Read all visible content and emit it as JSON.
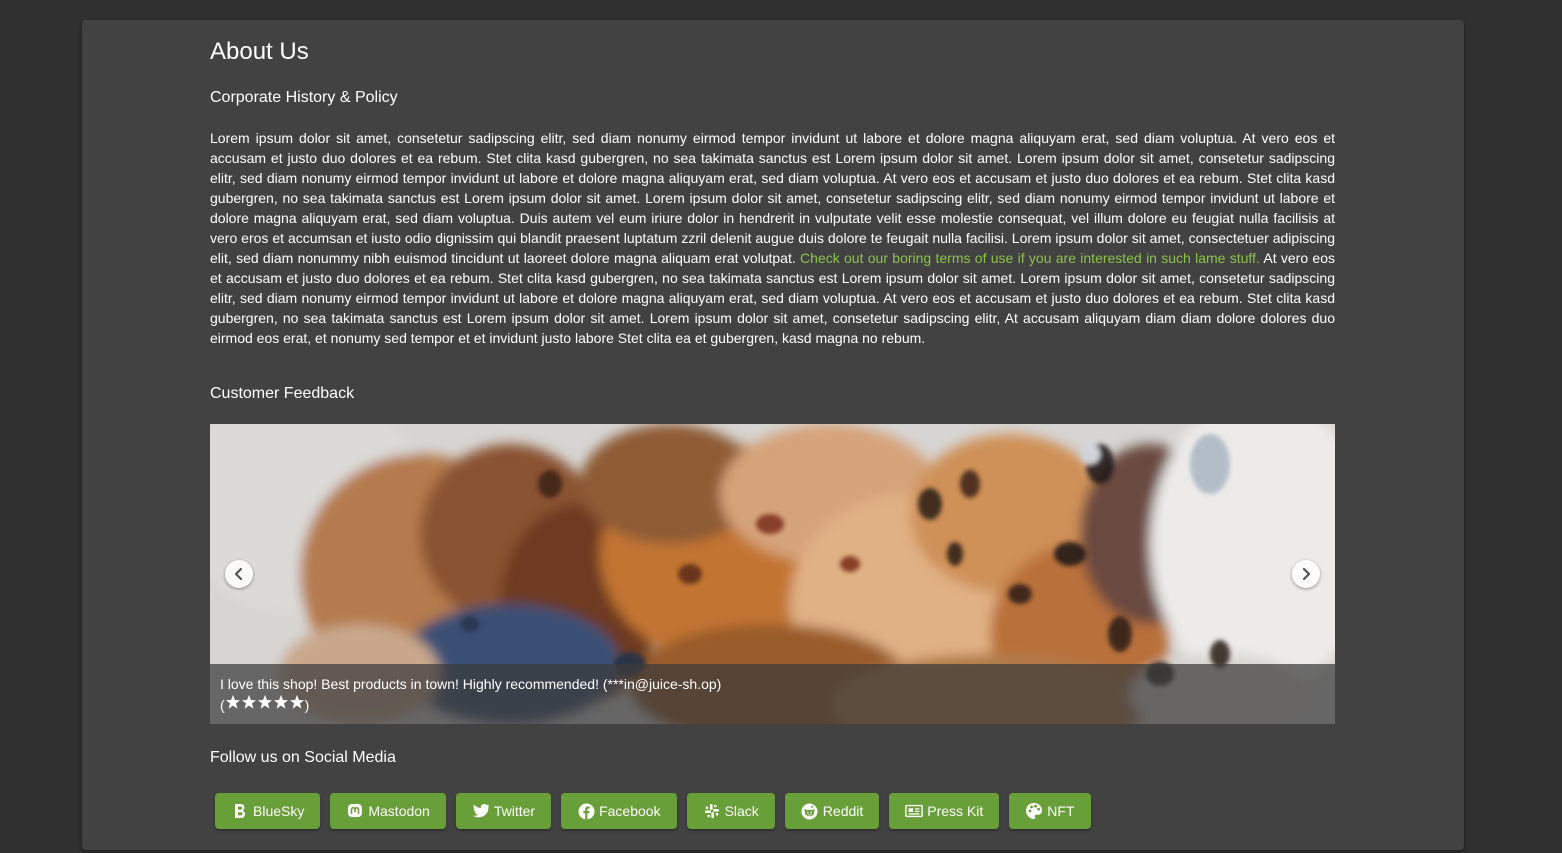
{
  "page": {
    "title": "About Us",
    "corporate_heading": "Corporate History & Policy",
    "policy_text_before": "Lorem ipsum dolor sit amet, consetetur sadipscing elitr, sed diam nonumy eirmod tempor invidunt ut labore et dolore magna aliquyam erat, sed diam voluptua. At vero eos et accusam et justo duo dolores et ea rebum. Stet clita kasd gubergren, no sea takimata sanctus est Lorem ipsum dolor sit amet. Lorem ipsum dolor sit amet, consetetur sadipscing elitr, sed diam nonumy eirmod tempor invidunt ut labore et dolore magna aliquyam erat, sed diam voluptua. At vero eos et accusam et justo duo dolores et ea rebum. Stet clita kasd gubergren, no sea takimata sanctus est Lorem ipsum dolor sit amet. Lorem ipsum dolor sit amet, consetetur sadipscing elitr, sed diam nonumy eirmod tempor invidunt ut labore et dolore magna aliquyam erat, sed diam voluptua. Duis autem vel eum iriure dolor in hendrerit in vulputate velit esse molestie consequat, vel illum dolore eu feugiat nulla facilisis at vero eros et accumsan et iusto odio dignissim qui blandit praesent luptatum zzril delenit augue duis dolore te feugait nulla facilisi. Lorem ipsum dolor sit amet, consectetuer adipiscing elit, sed diam nonummy nibh euismod tincidunt ut laoreet dolore magna aliquam erat volutpat.",
    "policy_link": "Check out our boring terms of use if you are interested in such lame stuff.",
    "policy_text_after": "At vero eos et accusam et justo duo dolores et ea rebum. Stet clita kasd gubergren, no sea takimata sanctus est Lorem ipsum dolor sit amet. Lorem ipsum dolor sit amet, consetetur sadipscing elitr, sed diam nonumy eirmod tempor invidunt ut labore et dolore magna aliquyam erat, sed diam voluptua. At vero eos et accusam et justo duo dolores et ea rebum. Stet clita kasd gubergren, no sea takimata sanctus est Lorem ipsum dolor sit amet. Lorem ipsum dolor sit amet, consetetur sadipscing elitr, At accusam aliquyam diam diam dolore dolores duo eirmod eos erat, et nonumy sed tempor et et invidunt justo labore Stet clita ea et gubergren, kasd magna no rebum.",
    "feedback_heading": "Customer Feedback",
    "social_heading": "Follow us on Social Media"
  },
  "carousel": {
    "caption": "I love this shop! Best products in town! Highly recommended! (***in@juice-sh.op)",
    "rating": 5,
    "rating_open": "(",
    "rating_close": ")",
    "prev_icon": "chevron-left-icon",
    "next_icon": "chevron-right-icon"
  },
  "social": [
    {
      "label": "BlueSky",
      "icon": "bluesky-icon"
    },
    {
      "label": "Mastodon",
      "icon": "mastodon-icon"
    },
    {
      "label": "Twitter",
      "icon": "twitter-icon"
    },
    {
      "label": "Facebook",
      "icon": "facebook-icon"
    },
    {
      "label": "Slack",
      "icon": "slack-icon"
    },
    {
      "label": "Reddit",
      "icon": "reddit-icon"
    },
    {
      "label": "Press Kit",
      "icon": "newspaper-icon"
    },
    {
      "label": "NFT",
      "icon": "palette-icon"
    }
  ],
  "colors": {
    "background": "#303030",
    "card": "#424242",
    "accent_button": "#689f38",
    "link": "#8bc34a"
  }
}
